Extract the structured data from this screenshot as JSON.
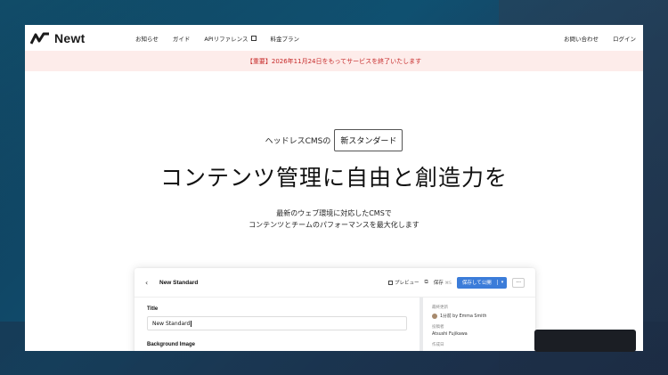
{
  "brand": {
    "name": "Newt"
  },
  "nav": {
    "items": [
      "お知らせ",
      "ガイド",
      "APIリファレンス",
      "料金プラン"
    ],
    "contact": "お問い合わせ",
    "login": "ログイン"
  },
  "announcement": "【重要】2026年11月24日をもってサービスを終了いたします",
  "hero": {
    "tagline_prefix": "ヘッドレスCMSの",
    "tagline_badge": "新スタンダード",
    "headline": "コンテンツ管理に自由と創造力を",
    "desc_line1": "最新のウェブ環境に対応したCMSで",
    "desc_line2": "コンテンツとチームのパフォーマンスを最大化します"
  },
  "preview": {
    "back": "‹",
    "title": "New Standard",
    "preview_label": "プレビュー",
    "save_label": "保存",
    "save_shortcut": "⌘S",
    "publish_label": "保存して公開",
    "publish_caret": "▾",
    "more": "···",
    "field_title_label": "Title",
    "field_title_value": "New Standard",
    "field_bg_label": "Background Image",
    "side": {
      "updated_key": "最終更新",
      "updated_value": "1分前 by Emma Smith",
      "author_key": "投稿者",
      "author_value": "Atsushi Fujikawa",
      "created_key": "作成日"
    }
  },
  "colors": {
    "accent": "#3b7cd9",
    "alert": "#c62828",
    "alert_bg": "#fdecea"
  }
}
